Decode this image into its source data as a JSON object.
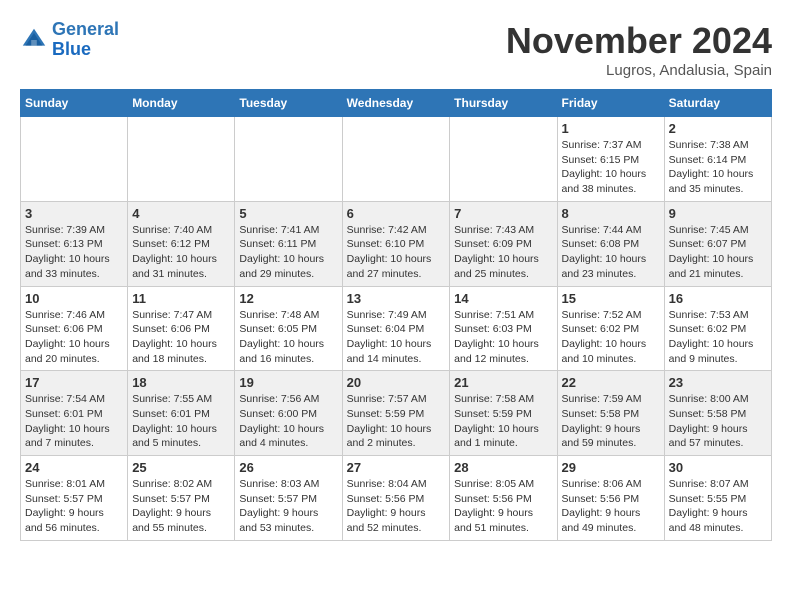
{
  "header": {
    "logo": {
      "line1": "General",
      "line2": "Blue"
    },
    "title": "November 2024",
    "location": "Lugros, Andalusia, Spain"
  },
  "days_of_week": [
    "Sunday",
    "Monday",
    "Tuesday",
    "Wednesday",
    "Thursday",
    "Friday",
    "Saturday"
  ],
  "weeks": [
    [
      {
        "day": "",
        "info": ""
      },
      {
        "day": "",
        "info": ""
      },
      {
        "day": "",
        "info": ""
      },
      {
        "day": "",
        "info": ""
      },
      {
        "day": "",
        "info": ""
      },
      {
        "day": "1",
        "info": "Sunrise: 7:37 AM\nSunset: 6:15 PM\nDaylight: 10 hours and 38 minutes."
      },
      {
        "day": "2",
        "info": "Sunrise: 7:38 AM\nSunset: 6:14 PM\nDaylight: 10 hours and 35 minutes."
      }
    ],
    [
      {
        "day": "3",
        "info": "Sunrise: 7:39 AM\nSunset: 6:13 PM\nDaylight: 10 hours and 33 minutes."
      },
      {
        "day": "4",
        "info": "Sunrise: 7:40 AM\nSunset: 6:12 PM\nDaylight: 10 hours and 31 minutes."
      },
      {
        "day": "5",
        "info": "Sunrise: 7:41 AM\nSunset: 6:11 PM\nDaylight: 10 hours and 29 minutes."
      },
      {
        "day": "6",
        "info": "Sunrise: 7:42 AM\nSunset: 6:10 PM\nDaylight: 10 hours and 27 minutes."
      },
      {
        "day": "7",
        "info": "Sunrise: 7:43 AM\nSunset: 6:09 PM\nDaylight: 10 hours and 25 minutes."
      },
      {
        "day": "8",
        "info": "Sunrise: 7:44 AM\nSunset: 6:08 PM\nDaylight: 10 hours and 23 minutes."
      },
      {
        "day": "9",
        "info": "Sunrise: 7:45 AM\nSunset: 6:07 PM\nDaylight: 10 hours and 21 minutes."
      }
    ],
    [
      {
        "day": "10",
        "info": "Sunrise: 7:46 AM\nSunset: 6:06 PM\nDaylight: 10 hours and 20 minutes."
      },
      {
        "day": "11",
        "info": "Sunrise: 7:47 AM\nSunset: 6:06 PM\nDaylight: 10 hours and 18 minutes."
      },
      {
        "day": "12",
        "info": "Sunrise: 7:48 AM\nSunset: 6:05 PM\nDaylight: 10 hours and 16 minutes."
      },
      {
        "day": "13",
        "info": "Sunrise: 7:49 AM\nSunset: 6:04 PM\nDaylight: 10 hours and 14 minutes."
      },
      {
        "day": "14",
        "info": "Sunrise: 7:51 AM\nSunset: 6:03 PM\nDaylight: 10 hours and 12 minutes."
      },
      {
        "day": "15",
        "info": "Sunrise: 7:52 AM\nSunset: 6:02 PM\nDaylight: 10 hours and 10 minutes."
      },
      {
        "day": "16",
        "info": "Sunrise: 7:53 AM\nSunset: 6:02 PM\nDaylight: 10 hours and 9 minutes."
      }
    ],
    [
      {
        "day": "17",
        "info": "Sunrise: 7:54 AM\nSunset: 6:01 PM\nDaylight: 10 hours and 7 minutes."
      },
      {
        "day": "18",
        "info": "Sunrise: 7:55 AM\nSunset: 6:01 PM\nDaylight: 10 hours and 5 minutes."
      },
      {
        "day": "19",
        "info": "Sunrise: 7:56 AM\nSunset: 6:00 PM\nDaylight: 10 hours and 4 minutes."
      },
      {
        "day": "20",
        "info": "Sunrise: 7:57 AM\nSunset: 5:59 PM\nDaylight: 10 hours and 2 minutes."
      },
      {
        "day": "21",
        "info": "Sunrise: 7:58 AM\nSunset: 5:59 PM\nDaylight: 10 hours and 1 minute."
      },
      {
        "day": "22",
        "info": "Sunrise: 7:59 AM\nSunset: 5:58 PM\nDaylight: 9 hours and 59 minutes."
      },
      {
        "day": "23",
        "info": "Sunrise: 8:00 AM\nSunset: 5:58 PM\nDaylight: 9 hours and 57 minutes."
      }
    ],
    [
      {
        "day": "24",
        "info": "Sunrise: 8:01 AM\nSunset: 5:57 PM\nDaylight: 9 hours and 56 minutes."
      },
      {
        "day": "25",
        "info": "Sunrise: 8:02 AM\nSunset: 5:57 PM\nDaylight: 9 hours and 55 minutes."
      },
      {
        "day": "26",
        "info": "Sunrise: 8:03 AM\nSunset: 5:57 PM\nDaylight: 9 hours and 53 minutes."
      },
      {
        "day": "27",
        "info": "Sunrise: 8:04 AM\nSunset: 5:56 PM\nDaylight: 9 hours and 52 minutes."
      },
      {
        "day": "28",
        "info": "Sunrise: 8:05 AM\nSunset: 5:56 PM\nDaylight: 9 hours and 51 minutes."
      },
      {
        "day": "29",
        "info": "Sunrise: 8:06 AM\nSunset: 5:56 PM\nDaylight: 9 hours and 49 minutes."
      },
      {
        "day": "30",
        "info": "Sunrise: 8:07 AM\nSunset: 5:55 PM\nDaylight: 9 hours and 48 minutes."
      }
    ]
  ]
}
